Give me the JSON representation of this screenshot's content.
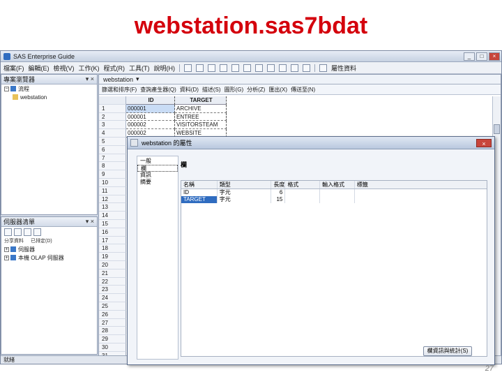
{
  "slide": {
    "title": "webstation.sas7bdat",
    "page_number": "27"
  },
  "app": {
    "title": "SAS Enterprise Guide",
    "window_buttons": [
      "_",
      "□",
      "×"
    ],
    "menus": [
      "檔案(F)",
      "編輯(E)",
      "檢視(V)",
      "工作(K)",
      "程式(R)",
      "工具(T)",
      "說明(H)"
    ],
    "toolbar_label": "屬性資料"
  },
  "project_pane": {
    "title": "專案瀏覽器",
    "root": "流程",
    "child": "webstation"
  },
  "task_pane": {
    "title": "伺服器清單",
    "links": [
      "分享資料",
      "已排定(D)"
    ],
    "items": [
      "伺服器",
      "本機 OLAP 伺服器"
    ]
  },
  "main": {
    "tab": "webstation",
    "toolbar": [
      "篩選和排序(F)",
      "查詢產生器(Q)",
      "資料(D)",
      "描述(S)",
      "圖形(G)",
      "分析(Z)",
      "匯出(X)",
      "傳送至(N)"
    ],
    "columns": [
      "ID",
      "TARGET"
    ],
    "rows": [
      {
        "n": "1",
        "id": "000001",
        "target": "ARCHIVE"
      },
      {
        "n": "2",
        "id": "000001",
        "target": "ENTREE"
      },
      {
        "n": "3",
        "id": "000002",
        "target": "VISITORSTEAM"
      },
      {
        "n": "4",
        "id": "000002",
        "target": "WEBSITE"
      },
      {
        "n": "5"
      },
      {
        "n": "6"
      },
      {
        "n": "7"
      },
      {
        "n": "8"
      },
      {
        "n": "9"
      },
      {
        "n": "10"
      },
      {
        "n": "11"
      },
      {
        "n": "12"
      },
      {
        "n": "13"
      },
      {
        "n": "14"
      },
      {
        "n": "15"
      },
      {
        "n": "16"
      },
      {
        "n": "17"
      },
      {
        "n": "18"
      },
      {
        "n": "19"
      },
      {
        "n": "20"
      },
      {
        "n": "21"
      },
      {
        "n": "22"
      },
      {
        "n": "23"
      },
      {
        "n": "24"
      },
      {
        "n": "25"
      },
      {
        "n": "26"
      },
      {
        "n": "27"
      },
      {
        "n": "28"
      },
      {
        "n": "29"
      },
      {
        "n": "30"
      },
      {
        "n": "31"
      }
    ]
  },
  "dialog": {
    "title": "webstation 的屬性",
    "close": "×",
    "nav": [
      "一般",
      "欄",
      "資訊",
      "摘要"
    ],
    "heading": "欄",
    "headers": [
      "名稱",
      "類型",
      "長度",
      "格式",
      "輸入格式",
      "標籤"
    ],
    "columns": [
      {
        "name": "ID",
        "type": "字元",
        "length": "6",
        "format": "",
        "informat": "",
        "label": ""
      },
      {
        "name": "TARGET",
        "type": "字元",
        "length": "15",
        "format": "",
        "informat": "",
        "label": ""
      }
    ],
    "button": "欄資訊與統計(S)"
  },
  "statusbar": {
    "text": "就緒"
  }
}
